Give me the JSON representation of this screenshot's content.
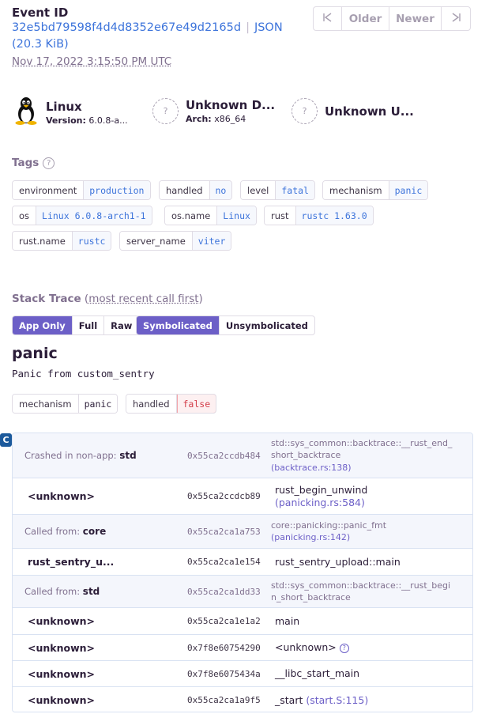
{
  "event": {
    "title": "Event ID",
    "id": "32e5bd79598f4d4d8352e67e49d2165d",
    "json_link": "JSON",
    "size": "(20.3 KiB)",
    "date": "Nov 17, 2022 3:15:50 PM UTC"
  },
  "pager": {
    "first_icon": "⇤",
    "older": "Older",
    "newer": "Newer",
    "last_icon": "⇥"
  },
  "contexts": [
    {
      "icon": "linux-tux-icon",
      "title": "Linux",
      "sub_label": "Version:",
      "sub_value": "6.0.8-a..."
    },
    {
      "icon": "unknown-device-icon",
      "title": "Unknown D...",
      "sub_label": "Arch:",
      "sub_value": "x86_64"
    },
    {
      "icon": "unknown-user-icon",
      "title": "Unknown U...",
      "sub_label": "",
      "sub_value": ""
    }
  ],
  "tags": {
    "heading": "Tags",
    "help_glyph": "?",
    "items": [
      {
        "key": "environment",
        "value": "production"
      },
      {
        "key": "handled",
        "value": "no"
      },
      {
        "key": "level",
        "value": "fatal"
      },
      {
        "key": "mechanism",
        "value": "panic"
      },
      {
        "key": "os",
        "value": "Linux 6.0.8-arch1-1"
      },
      {
        "key": "os.name",
        "value": "Linux"
      },
      {
        "key": "rust",
        "value": "rustc 1.63.0"
      },
      {
        "key": "rust.name",
        "value": "rustc"
      },
      {
        "key": "server_name",
        "value": "viter"
      }
    ]
  },
  "stack_trace": {
    "heading": "Stack Trace",
    "heading_paren_open": "(",
    "heading_link": "most recent call first",
    "heading_paren_close": ")",
    "view_buttons": [
      "App Only",
      "Full",
      "Raw"
    ],
    "active_view": "App Only",
    "symbol_buttons": [
      "Symbolicated",
      "Unsymbolicated"
    ],
    "active_symbol": "Symbolicated"
  },
  "exception": {
    "type": "panic",
    "value": "Panic from custom_sentry",
    "mechanism_tags": [
      {
        "key": "mechanism",
        "value": "panic"
      },
      {
        "key": "handled",
        "value": "false"
      }
    ]
  },
  "platform_icon_glyph": "C",
  "frames": [
    {
      "kind": "dim",
      "prefix": "Crashed in non-app:",
      "package": "std",
      "address": "0x55ca2ccdb484",
      "function": "std::sys_common::backtrace::__rust_end_short_backtrace",
      "file": "(backtrace.rs:138)"
    },
    {
      "kind": "bright",
      "prefix": "",
      "package": "<unknown>",
      "address": "0x55ca2ccdcb89",
      "function": "rust_begin_unwind",
      "file": "(panicking.rs:584)"
    },
    {
      "kind": "dim",
      "prefix": "Called from:",
      "package": "core",
      "address": "0x55ca2ca1a753",
      "function": "core::panicking::panic_fmt",
      "file": "(panicking.rs:142)"
    },
    {
      "kind": "bright",
      "prefix": "",
      "package": "rust_sentry_u...",
      "address": "0x55ca2ca1e154",
      "function": "rust_sentry_upload::main",
      "file": ""
    },
    {
      "kind": "dim",
      "prefix": "Called from:",
      "package": "std",
      "address": "0x55ca2ca1dd33",
      "function": "std::sys_common::backtrace::__rust_begin_short_backtrace",
      "file": ""
    },
    {
      "kind": "bright",
      "prefix": "",
      "package": "<unknown>",
      "address": "0x55ca2ca1e1a2",
      "function": "main",
      "file": ""
    },
    {
      "kind": "bright",
      "prefix": "",
      "package": "<unknown>",
      "address": "0x7f8e60754290",
      "function": "<unknown>",
      "file": "",
      "help": "?"
    },
    {
      "kind": "bright",
      "prefix": "",
      "package": "<unknown>",
      "address": "0x7f8e6075434a",
      "function": "__libc_start_main",
      "file": ""
    },
    {
      "kind": "bright",
      "prefix": "",
      "package": "<unknown>",
      "address": "0x55ca2ca1a9f5",
      "function": "_start",
      "file": "(start.S:115)"
    }
  ]
}
